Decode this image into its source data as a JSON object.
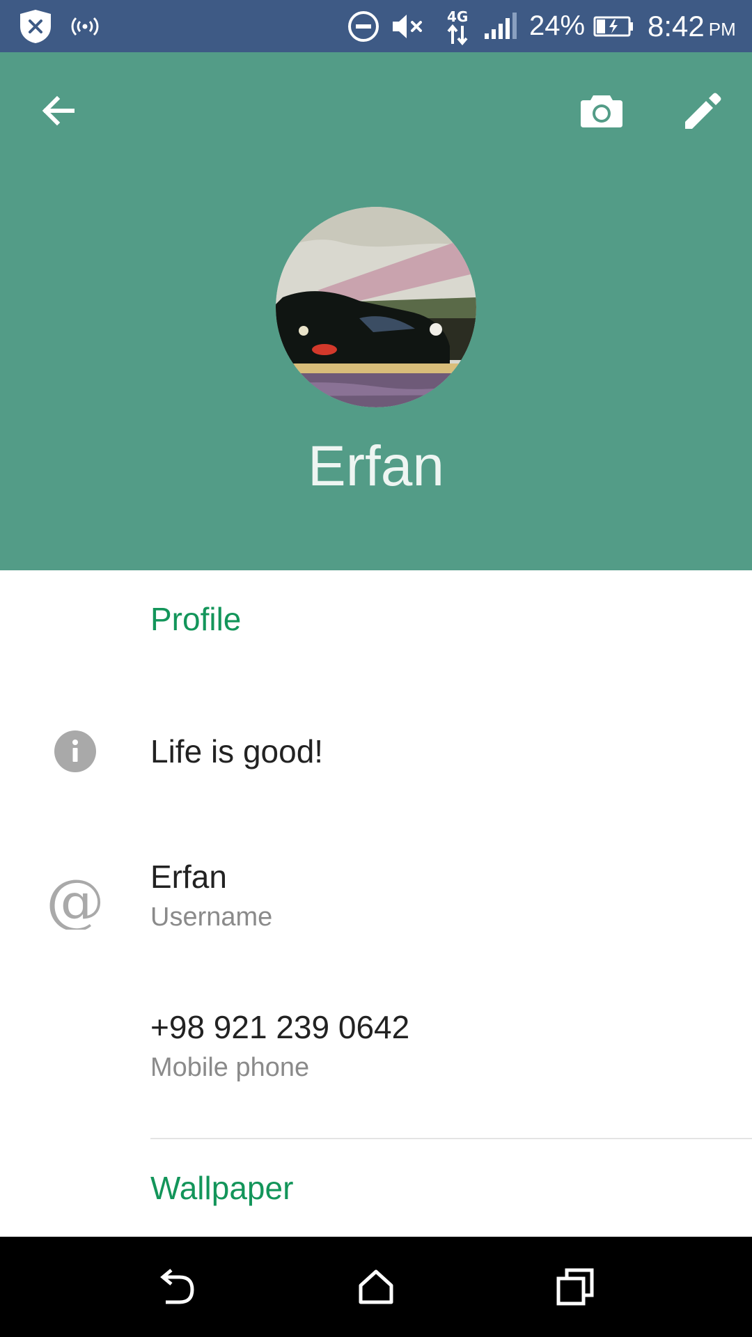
{
  "status_bar": {
    "battery_percent": "24%",
    "time": "8:42",
    "ampm": "PM",
    "network_type": "4G",
    "icons": [
      "shield-icon",
      "hotspot-icon",
      "do-not-disturb-icon",
      "volume-muted-icon",
      "network-4g-icon",
      "signal-icon",
      "battery-charging-icon"
    ]
  },
  "header": {
    "name": "Erfan",
    "icons": [
      "back-arrow-icon",
      "camera-icon",
      "edit-pencil-icon"
    ]
  },
  "sections": {
    "profile_label": "Profile",
    "wallpaper_label": "Wallpaper"
  },
  "profile": {
    "status": "Life is good!",
    "username": "Erfan",
    "username_label": "Username",
    "phone": "+98 921 239 0642",
    "phone_label": "Mobile phone",
    "icons": [
      "info-icon",
      "at-sign-icon"
    ]
  },
  "nav_bar": {
    "icons": [
      "nav-back-icon",
      "nav-home-icon",
      "nav-recents-icon"
    ]
  },
  "colors": {
    "status_bar": "#3e5a85",
    "header": "#539c87",
    "accent_green": "#13955a",
    "primary_text": "#222222",
    "secondary_text": "#8a8a8a",
    "icon_gray": "#a9a9a9",
    "nav_bar": "#000000"
  }
}
